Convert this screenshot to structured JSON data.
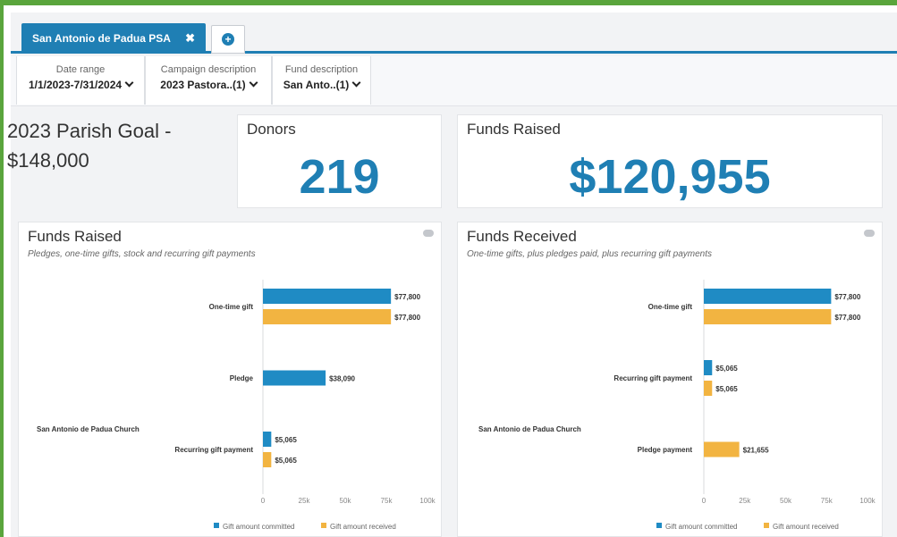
{
  "tabs": [
    {
      "label": "San Antonio de Padua PSA",
      "close": "✖"
    }
  ],
  "add_tab": "+",
  "filters": [
    {
      "label": "Date range",
      "value": "1/1/2023-7/31/2024"
    },
    {
      "label": "Campaign description",
      "value": "2023 Pastora..(1)"
    },
    {
      "label": "Fund description",
      "value": "San Anto..(1)"
    }
  ],
  "goal": {
    "line1": "2023 Parish Goal -",
    "line2": "$148,000"
  },
  "donors": {
    "title": "Donors",
    "value": "219"
  },
  "funds_raised_total": {
    "title": "Funds Raised",
    "value": "$120,955"
  },
  "panels": [
    {
      "title": "Funds Raised",
      "subtitle": "Pledges, one-time gifts, stock and recurring gift payments"
    },
    {
      "title": "Funds Received",
      "subtitle": "One-time gifts, plus pledges paid, plus recurring gift payments"
    }
  ],
  "colors": {
    "committed": "#1f8bc4",
    "received": "#f2b441",
    "accent": "#1f7fb4"
  },
  "chart_data": [
    {
      "type": "bar",
      "orientation": "horizontal",
      "group_label": "San Antonio de Padua Church",
      "categories": [
        "One-time gift",
        "Pledge",
        "Recurring gift payment"
      ],
      "series": [
        {
          "name": "Gift amount committed",
          "values": [
            77800,
            38090,
            5065
          ],
          "labels": [
            "$77,800",
            "$38,090",
            "$5,065"
          ]
        },
        {
          "name": "Gift amount received",
          "values": [
            77800,
            null,
            5065
          ],
          "labels": [
            "$77,800",
            "",
            "$5,065"
          ]
        }
      ],
      "xlim": [
        0,
        100000
      ],
      "xticks": [
        "0",
        "25k",
        "50k",
        "75k",
        "100k"
      ],
      "legend_position": "bottom"
    },
    {
      "type": "bar",
      "orientation": "horizontal",
      "group_label": "San Antonio de Padua Church",
      "categories": [
        "One-time gift",
        "Recurring gift payment",
        "Pledge payment"
      ],
      "series": [
        {
          "name": "Gift amount committed",
          "values": [
            77800,
            5065,
            null
          ],
          "labels": [
            "$77,800",
            "$5,065",
            ""
          ]
        },
        {
          "name": "Gift amount received",
          "values": [
            77800,
            5065,
            21655
          ],
          "labels": [
            "$77,800",
            "$5,065",
            "$21,655"
          ]
        }
      ],
      "xlim": [
        0,
        100000
      ],
      "xticks": [
        "0",
        "25k",
        "50k",
        "75k",
        "100k"
      ],
      "legend_position": "bottom"
    }
  ]
}
